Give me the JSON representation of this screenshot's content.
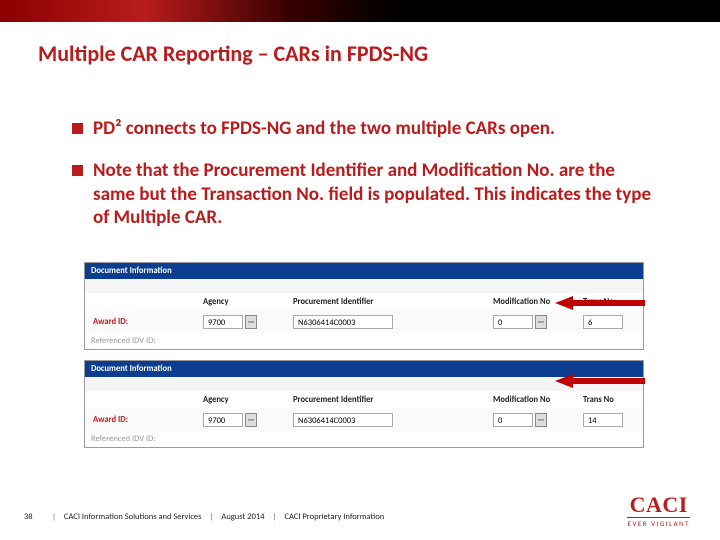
{
  "title": "Multiple CAR Reporting – CARs in FPDS-NG",
  "bullets": [
    "PD² connects to FPDS-NG and the two multiple CARs open.",
    "Note that the Procurement Identifier and Modification No. are the same but the Transaction No. field is populated.  This indicates the type of Multiple CAR."
  ],
  "panels": [
    {
      "header": "Document Information",
      "cols": {
        "agency": "Agency",
        "procId": "Procurement Identifier",
        "modNo": "Modification No",
        "transNo": "Trans No"
      },
      "awardLabel": "Award ID:",
      "agencyVal": "9700",
      "procIdVal": "N6306414C0003",
      "modNoVal": "0",
      "transNoVal": "6",
      "refLabel": "Referenced IDV ID:"
    },
    {
      "header": "Document Information",
      "cols": {
        "agency": "Agency",
        "procId": "Procurement Identifier",
        "modNo": "Modification No",
        "transNo": "Trans No"
      },
      "awardLabel": "Award ID:",
      "agencyVal": "9700",
      "procIdVal": "N6306414C0003",
      "modNoVal": "0",
      "transNoVal": "14",
      "refLabel": "Referenced IDV ID:"
    }
  ],
  "footer": {
    "page": "38",
    "org": "CACI Information Solutions and Services",
    "date": "August 2014",
    "rights": "CACI Proprietary Information"
  },
  "logo": {
    "brand": "CACI",
    "tagline": "EVER VIGILANT"
  }
}
